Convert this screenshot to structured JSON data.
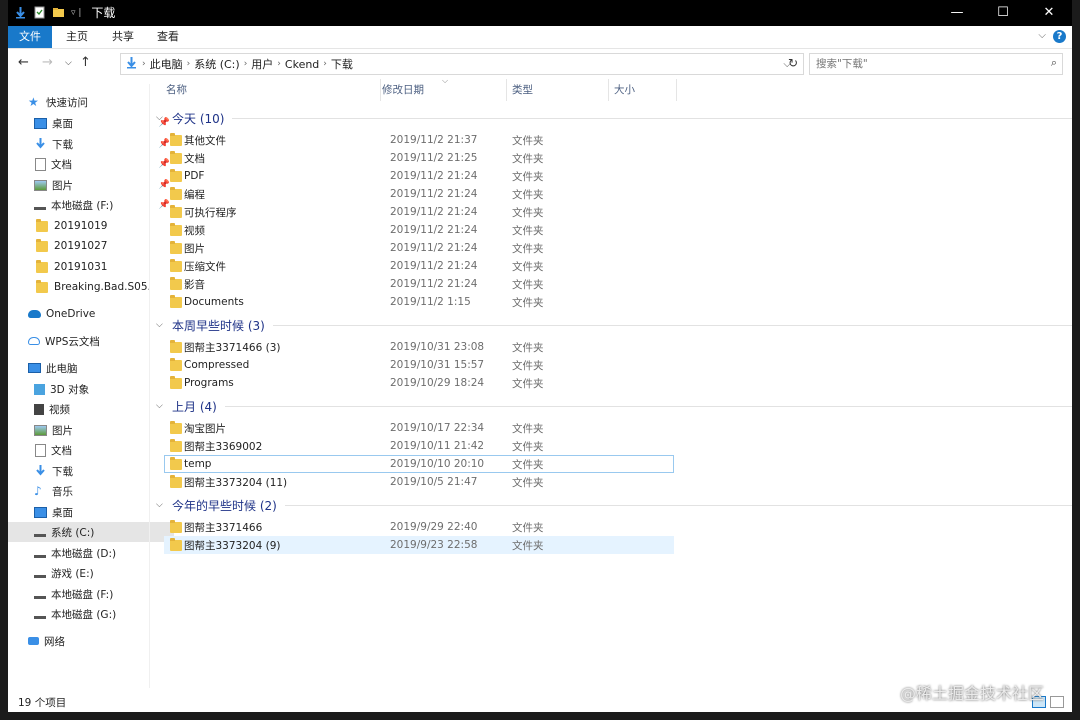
{
  "window": {
    "title": "下载",
    "controls": [
      "—",
      "☐",
      "✕"
    ]
  },
  "ribbon": {
    "tabs": [
      "文件",
      "主页",
      "共享",
      "查看"
    ],
    "help": "?"
  },
  "nav": {
    "breadcrumb": [
      "此电脑",
      "系统 (C:)",
      "用户",
      "Ckend",
      "下载"
    ],
    "search_placeholder": "搜索\"下载\""
  },
  "sidebar": {
    "quick_access": "快速访问",
    "quick_items": [
      "桌面",
      "下载",
      "文档",
      "图片",
      "本地磁盘 (F:)",
      "20191019",
      "20191027",
      "20191031",
      "Breaking.Bad.S05."
    ],
    "onedrive": "OneDrive",
    "wps": "WPS云文档",
    "this_pc": "此电脑",
    "pc_items": [
      "3D 对象",
      "视频",
      "图片",
      "文档",
      "下载",
      "音乐",
      "桌面",
      "系统 (C:)",
      "本地磁盘 (D:)",
      "游戏 (E:)",
      "本地磁盘 (F:)",
      "本地磁盘 (G:)"
    ],
    "network": "网络"
  },
  "columns": {
    "name": "名称",
    "date": "修改日期",
    "type": "类型",
    "size": "大小"
  },
  "groups": [
    {
      "label": "今天 (10)",
      "rows": [
        {
          "name": "其他文件",
          "date": "2019/11/2 21:37",
          "type": "文件夹"
        },
        {
          "name": "文档",
          "date": "2019/11/2 21:25",
          "type": "文件夹"
        },
        {
          "name": "PDF",
          "date": "2019/11/2 21:24",
          "type": "文件夹"
        },
        {
          "name": "编程",
          "date": "2019/11/2 21:24",
          "type": "文件夹"
        },
        {
          "name": "可执行程序",
          "date": "2019/11/2 21:24",
          "type": "文件夹"
        },
        {
          "name": "视频",
          "date": "2019/11/2 21:24",
          "type": "文件夹"
        },
        {
          "name": "图片",
          "date": "2019/11/2 21:24",
          "type": "文件夹"
        },
        {
          "name": "压缩文件",
          "date": "2019/11/2 21:24",
          "type": "文件夹"
        },
        {
          "name": "影音",
          "date": "2019/11/2 21:24",
          "type": "文件夹"
        },
        {
          "name": "Documents",
          "date": "2019/11/2 1:15",
          "type": "文件夹"
        }
      ]
    },
    {
      "label": "本周早些时候 (3)",
      "rows": [
        {
          "name": "图帮主3371466 (3)",
          "date": "2019/10/31 23:08",
          "type": "文件夹"
        },
        {
          "name": "Compressed",
          "date": "2019/10/31 15:57",
          "type": "文件夹"
        },
        {
          "name": "Programs",
          "date": "2019/10/29 18:24",
          "type": "文件夹"
        }
      ]
    },
    {
      "label": "上月 (4)",
      "rows": [
        {
          "name": "淘宝图片",
          "date": "2019/10/17 22:34",
          "type": "文件夹"
        },
        {
          "name": "图帮主3369002",
          "date": "2019/10/11 21:42",
          "type": "文件夹"
        },
        {
          "name": "temp",
          "date": "2019/10/10 20:10",
          "type": "文件夹"
        },
        {
          "name": "图帮主3373204 (11)",
          "date": "2019/10/5 21:47",
          "type": "文件夹"
        }
      ]
    },
    {
      "label": "今年的早些时候 (2)",
      "rows": [
        {
          "name": "图帮主3371466",
          "date": "2019/9/29 22:40",
          "type": "文件夹"
        },
        {
          "name": "图帮主3373204 (9)",
          "date": "2019/9/23 22:58",
          "type": "文件夹"
        }
      ]
    }
  ],
  "status": {
    "count": "19 个项目"
  },
  "watermark": "@稀土掘金技术社区",
  "colors": {
    "accent": "#1979ca",
    "group_text": "#1e3287",
    "folder": "#f2c94c"
  }
}
